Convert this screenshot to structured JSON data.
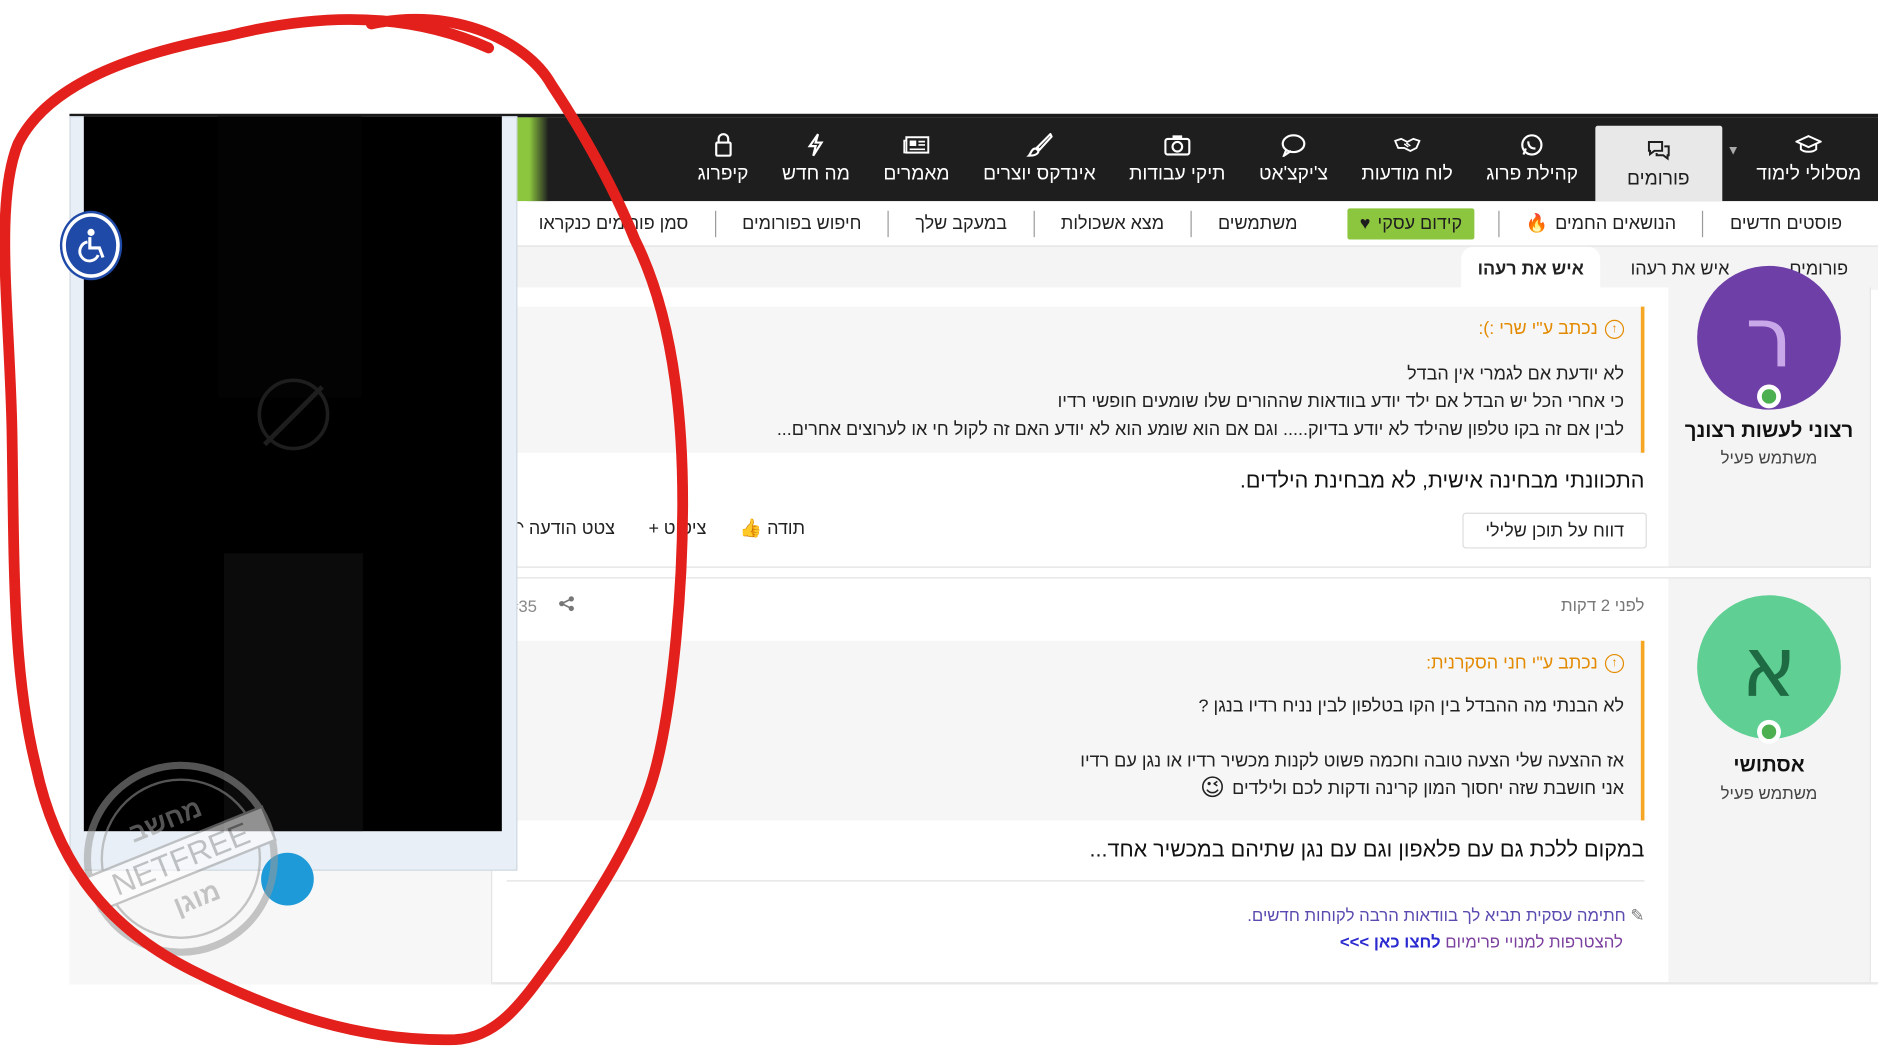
{
  "nav": {
    "items": [
      {
        "label": "מסלולי לימוד",
        "icon": "graduation-cap-icon"
      },
      {
        "label": "פורומים",
        "icon": "chat-bubbles-icon",
        "active": true
      },
      {
        "label": "קהילת פרוג",
        "icon": "whatsapp-icon"
      },
      {
        "label": "לוח מודעות",
        "icon": "handshake-icon"
      },
      {
        "label": "צ'יקצ'אט",
        "icon": "speech-bubble-icon"
      },
      {
        "label": "תיקי עבודות",
        "icon": "camera-icon"
      },
      {
        "label": "אינדקס יוצרים",
        "icon": "brush-icon"
      },
      {
        "label": "מאמרים",
        "icon": "newspaper-icon"
      },
      {
        "label": "מה חדש",
        "icon": "lightning-icon"
      },
      {
        "label": "קיפרוג",
        "icon": "lock-icon"
      }
    ]
  },
  "subnav": {
    "new_posts": "פוסטים חדשים",
    "hot_topics": "הנושאים החמים",
    "promo": "קידום עסקי",
    "members": "משתמשים",
    "find_jobs": "מצא אשכולות",
    "watched": "במעקב שלך",
    "search": "חיפוש בפורומים",
    "mark_read": "סמן פורומים כנקראו"
  },
  "breadcrumbs": [
    "פורומים",
    "איש את רעהו",
    "איש את רעהו"
  ],
  "post1": {
    "avatar_letter": "ר",
    "avatar_color": "#6f3fa8",
    "author": "רצוני לעשות רצונך",
    "role": "משתמש פעיל",
    "quote_head": "נכתב ע\"י שרי :):",
    "quote_lines": [
      "לא יודעת אם לגמרי אין הבדל",
      "כי אחרי הכל יש הבדל אם ילד יודע בוודאות שההורים שלו שומעים חופשי רדיו",
      "לבין אם זה בקו טלפון שהילד לא יודע בדיוק..... וגם אם הוא שומע הוא לא יודע האם זה לקול חי או לערוצים אחרים..."
    ],
    "text": "התכוונתי מבחינה אישית, לא מבחינת הילדים.",
    "report": "דווח על תוכן שלילי",
    "actions": {
      "thanks": "תודה",
      "quote_plus": "ציטוט",
      "reply": "צטט הודעה"
    }
  },
  "post2": {
    "avatar_letter": "א",
    "avatar_color": "#5fcf94",
    "author": "אסתושי",
    "role": "משתמש פעיל",
    "time": "לפני 2 דקות",
    "number": "#35",
    "quote_head": "נכתב ע\"י חני הסקרנית:",
    "quote_lines": [
      "לא הבנתי מה ההבדל בין הקו בטלפון לבין נניח רדיו בנגן ?",
      "",
      "אז ההצעה שלי הצעה טובה וחכמה פשוט לקנות מכשיר רדיו או נגן עם רדיו",
      "אני חושבת שזה יחסוך המון קרינה ודקות לכם ולילדים"
    ],
    "text": "במקום ללכת גם עם פלאפון וגם עם נגן שתיהם במכשיר אחד...",
    "signature_line1": "חתימה עסקית תביא לך בוודאות הרבה לקוחות חדשים.",
    "signature_line2_a": "להצטרפות למנויי פרימיום",
    "signature_line2_link": "לחצו כאן >>>"
  },
  "watermark": {
    "top": "מחשב",
    "middle": "NETFREE",
    "bottom": "מוגן"
  },
  "colors": {
    "accent_green": "#8cc63f",
    "annotation_red": "#e3201b",
    "navbar": "#1e1e1e",
    "quote_orange": "#f5a623"
  }
}
